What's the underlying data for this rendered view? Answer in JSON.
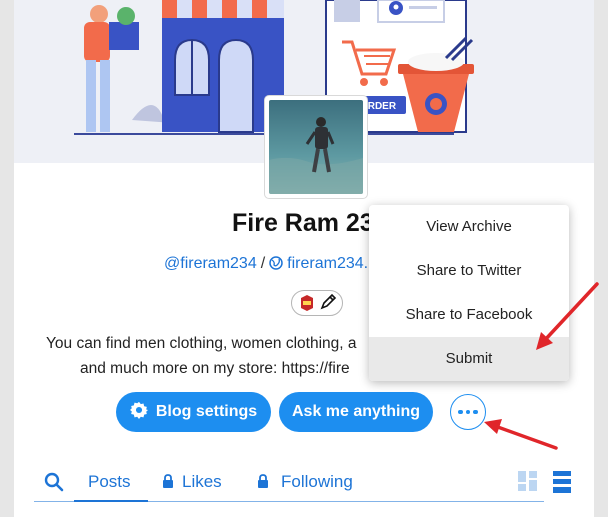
{
  "profile": {
    "title": "Fire Ram 23.",
    "username": "@fireram234",
    "separator": "/",
    "blog_url": "fireram234.",
    "description_line1": "You can find men clothing, women clothing, a",
    "description_line2": "and much more on my store: https://fire"
  },
  "banner": {
    "order_label": "ORDER"
  },
  "actions": {
    "blog_settings": "Blog settings",
    "ask_me_anything": "Ask me anything"
  },
  "tabs": {
    "posts": "Posts",
    "likes": "Likes",
    "following": "Following"
  },
  "menu": {
    "items": [
      "View Archive",
      "Share to Twitter",
      "Share to Facebook",
      "Submit"
    ],
    "highlighted": "Submit"
  },
  "colors": {
    "accent": "#1d8ef0",
    "link": "#1d74d6",
    "annotation_arrow": "#e0262a"
  },
  "icons": [
    "gear-icon",
    "search-icon",
    "lock-icon",
    "globe-icon",
    "pencil-icon",
    "grid-view-icon",
    "list-view-icon",
    "more-icon"
  ]
}
